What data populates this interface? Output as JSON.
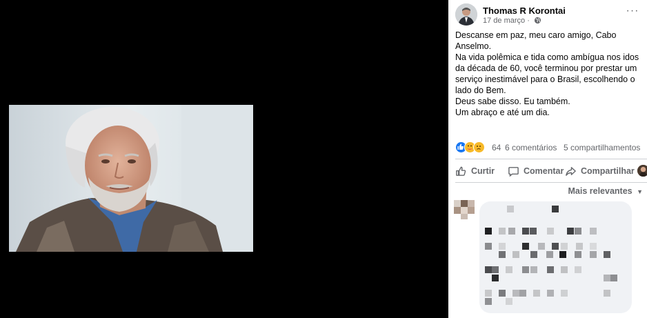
{
  "post": {
    "author": "Thomas R Korontai",
    "date": "17 de março",
    "more_icon": "···",
    "text_lines": [
      "Descanse em paz, meu caro amigo, Cabo Anselmo.",
      "Na vida polêmica e tida como ambígua nos idos da década de 60, você terminou por prestar um serviço inestimável para o Brasil, escolhendo o lado do Bem.",
      "Deus sabe disso. Eu também.",
      "Um abraço e até um dia."
    ]
  },
  "engagement": {
    "reactions_count": "64",
    "comments": "6 comentários",
    "shares": "5 compartilhamentos",
    "reaction_icons": [
      "like-icon",
      "care-icon",
      "sad-icon"
    ]
  },
  "actions": {
    "like": "Curtir",
    "comment": "Comentar",
    "share": "Compartilhar"
  },
  "comments_sort": "Mais relevantes",
  "colors": {
    "like_blue": "#1877f2",
    "care_yellow": "#f7b928",
    "secondary_text": "#65676b",
    "bubble_bg": "#f0f2f5"
  }
}
